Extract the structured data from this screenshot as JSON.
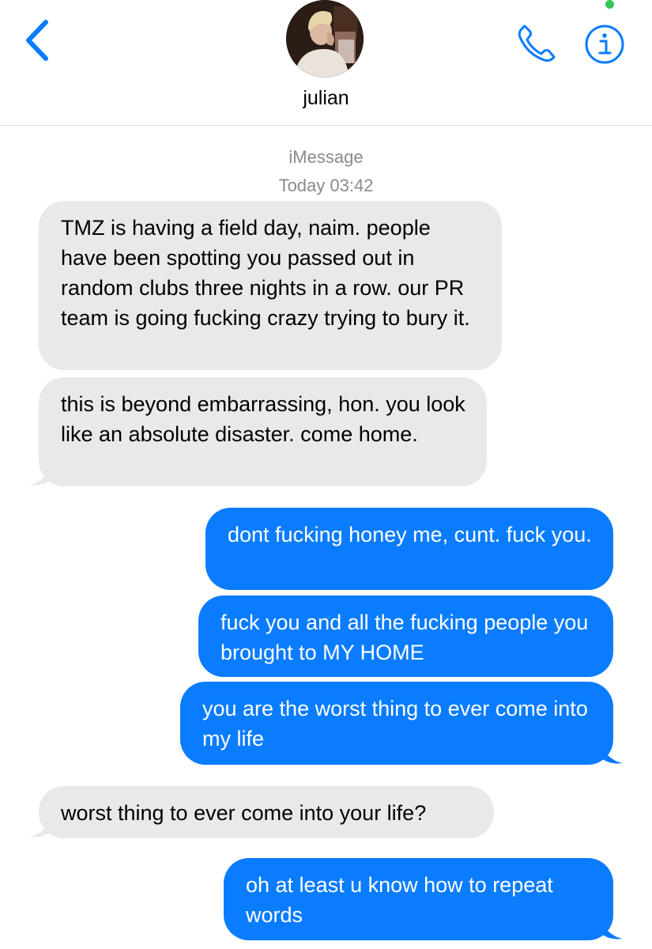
{
  "header": {
    "back_icon": "chevron-left-icon",
    "contact_name": "julian",
    "call_icon": "phone-icon",
    "info_icon": "info-icon",
    "accent_color": "#0a7cff",
    "status_dot_color": "#34c759"
  },
  "thread": {
    "service": "iMessage",
    "timestamp": "Today 03:42"
  },
  "messages": [
    {
      "direction": "incoming",
      "text": "TMZ is having a field day, naim. people have been spotting you passed out in random clubs three nights in a row. our PR team is going fucking crazy trying to bury it."
    },
    {
      "direction": "incoming",
      "text": "this is beyond embarrassing, hon. you look like an absolute disaster. come home."
    },
    {
      "direction": "outgoing",
      "text": "dont fucking honey me, cunt. fuck you."
    },
    {
      "direction": "outgoing",
      "text": "fuck you and all the fucking people you brought to MY HOME"
    },
    {
      "direction": "outgoing",
      "text": "you are the worst thing to ever come into my life"
    },
    {
      "direction": "incoming",
      "text": "worst thing to ever come into your life?"
    },
    {
      "direction": "outgoing",
      "text": "oh at least u know how to repeat words"
    }
  ],
  "colors": {
    "incoming_bubble": "#e9e9eb",
    "outgoing_bubble": "#0a7cff",
    "meta_text": "#8a8a8e"
  }
}
